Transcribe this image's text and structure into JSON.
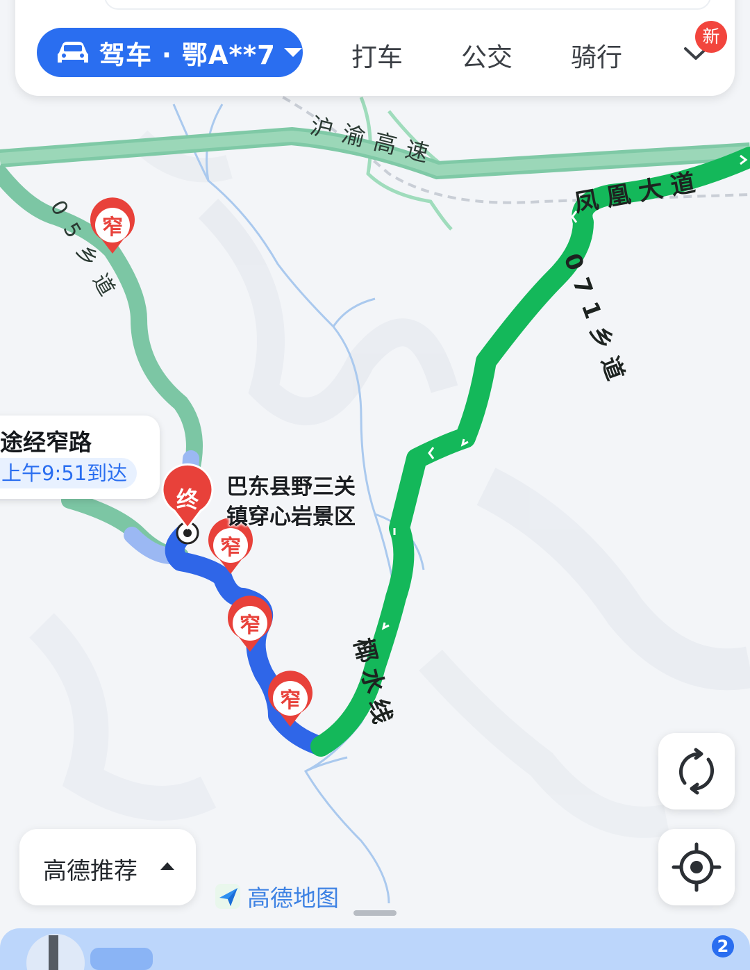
{
  "header": {
    "mode_label": "驾车 · 鄂A**7",
    "tabs": [
      "打车",
      "公交",
      "骑行"
    ],
    "new_badge": "新"
  },
  "map": {
    "road_labels": {
      "expressway": "沪渝高速",
      "avenue": "凤凰大道",
      "village_road_right": "071乡道",
      "village_road_left": "05乡道",
      "county_line": "椰水线"
    },
    "destination_marker": "终",
    "destination_name_line1": "巴东县野三关",
    "destination_name_line2": "镇穿心岩景区",
    "narrow_marker": "窄",
    "colors": {
      "smooth": "#14b85a",
      "alt_route": "#7cc6a4",
      "slow_blue": "#2f66e8",
      "marker_red": "#e8413a"
    }
  },
  "callout": {
    "title": "途经窄路",
    "eta": "上午9:51到达"
  },
  "recommend_label": "高德推荐",
  "watermark": "高德地图",
  "bottom_badge": "2",
  "controls": {
    "refresh": "refresh-icon",
    "locate": "locate-icon"
  }
}
